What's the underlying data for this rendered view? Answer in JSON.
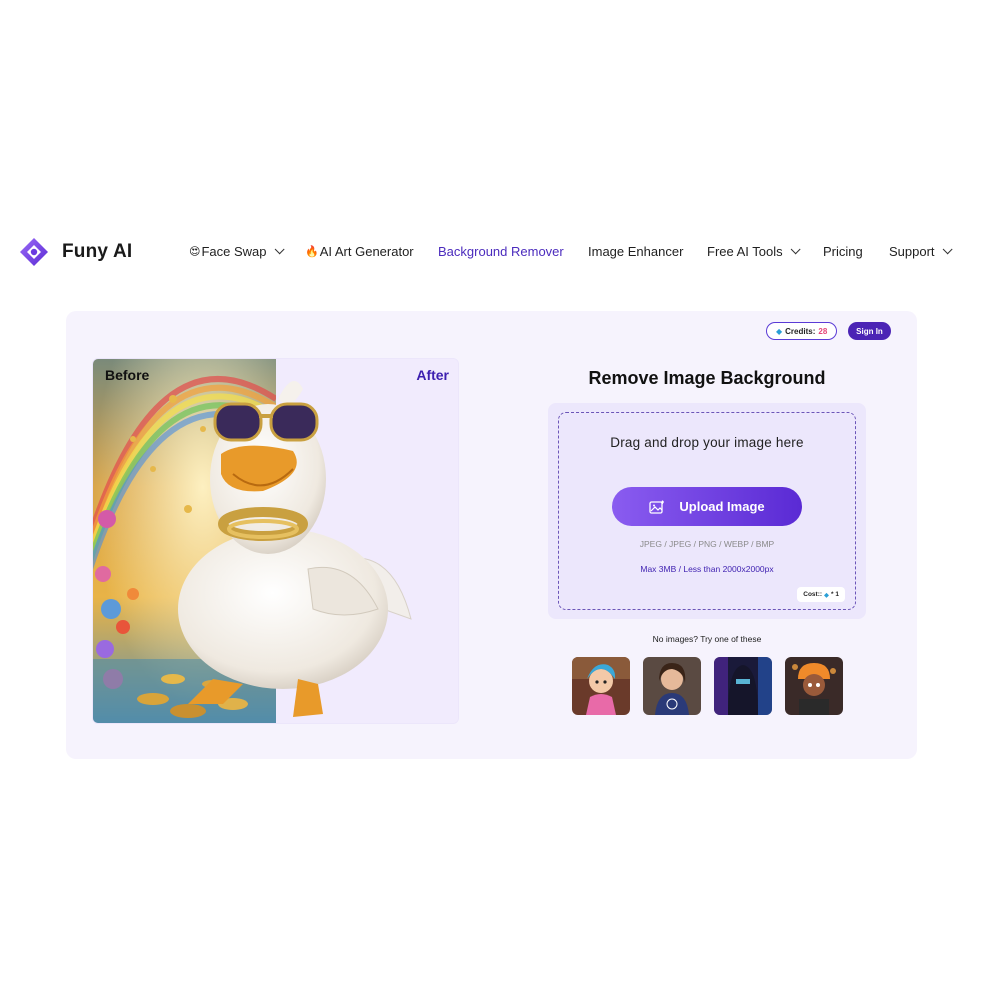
{
  "brand": {
    "name": "Funy AI"
  },
  "nav": {
    "items": [
      {
        "emoji": "😍",
        "label": "Face Swap",
        "dropdown": true
      },
      {
        "emoji": "🔥",
        "label": "AI Art Generator",
        "dropdown": false
      },
      {
        "emoji": "",
        "label": "Background Remover",
        "dropdown": false,
        "active": true
      },
      {
        "emoji": "",
        "label": "Image Enhancer",
        "dropdown": false
      },
      {
        "emoji": "",
        "label": "Free AI Tools",
        "dropdown": true
      },
      {
        "emoji": "",
        "label": "Pricing",
        "dropdown": false
      },
      {
        "emoji": "",
        "label": "Support",
        "dropdown": true
      }
    ]
  },
  "account": {
    "credits_label": "Credits:",
    "credits_value": "28",
    "signin_label": "Sign In"
  },
  "compare": {
    "before_label": "Before",
    "after_label": "After"
  },
  "tool": {
    "title": "Remove Image Background",
    "drop_text": "Drag and drop your image here",
    "upload_label": "Upload Image",
    "formats": "JPEG / JPEG / PNG / WEBP / BMP",
    "max_size": "Max 3MB / Less than 2000x2000px",
    "cost_label": "Cost::",
    "cost_value": "* 1"
  },
  "samples": {
    "prompt": "No images? Try one of these",
    "items": [
      "sample-girl-cartoon",
      "sample-woman-smiling",
      "sample-hooded-figure",
      "sample-kid-motorbike"
    ]
  },
  "colors": {
    "accent": "#4b24b5",
    "active_nav": "#4b2bbd",
    "card_bg": "#f6f3fd"
  }
}
